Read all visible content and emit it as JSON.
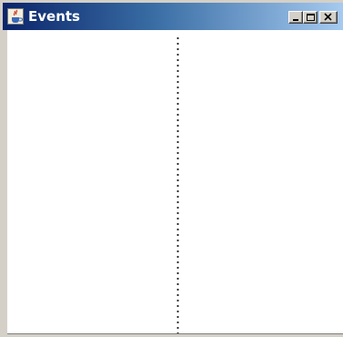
{
  "window": {
    "title": "Events",
    "icon": "java-cup-icon",
    "controls": {
      "minimize_icon": "minimize-icon",
      "maximize_icon": "maximize-icon",
      "close_icon": "close-icon"
    }
  },
  "colors": {
    "titlebar_start": "#0a246a",
    "titlebar_end": "#a6caf0",
    "frame": "#d4d0c8",
    "canvas": "#ffffff"
  }
}
